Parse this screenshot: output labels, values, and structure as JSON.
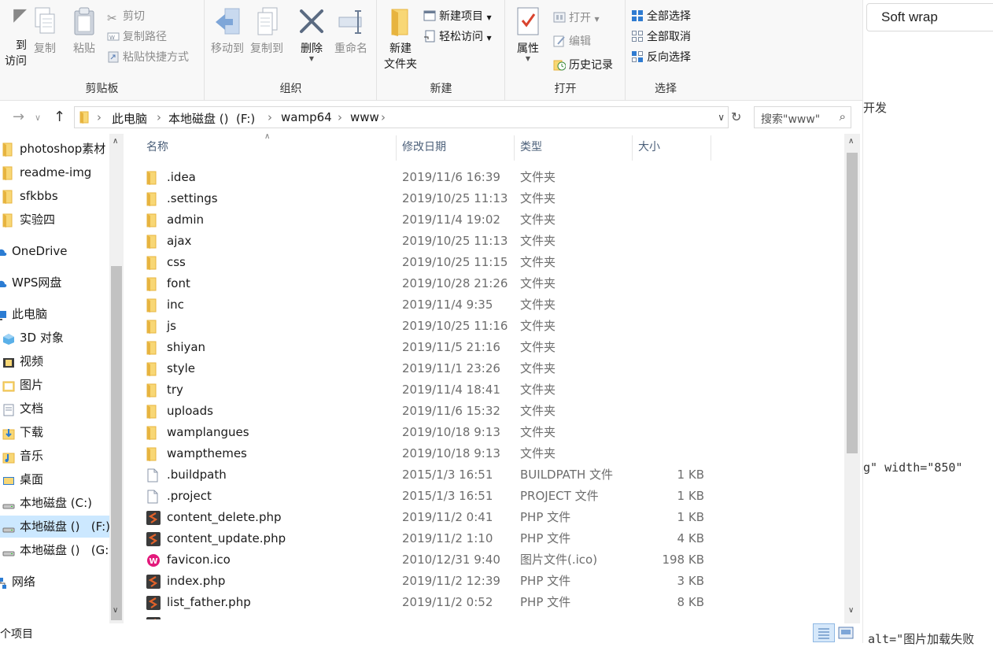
{
  "ribbon": {
    "clipboard": {
      "pin_label": "到\n访问",
      "copy": "复制",
      "paste": "粘贴",
      "cut": "剪切",
      "copy_path": "复制路径",
      "paste_shortcut": "粘贴快捷方式",
      "group_label": "剪贴板"
    },
    "organize": {
      "move_to": "移动到",
      "copy_to": "复制到",
      "delete": "删除",
      "rename": "重命名",
      "group_label": "组织"
    },
    "new": {
      "new_folder_1": "新建",
      "new_folder_2": "文件夹",
      "new_item": "新建项目",
      "easy_access": "轻松访问",
      "group_label": "新建"
    },
    "open": {
      "properties": "属性",
      "open": "打开",
      "edit": "编辑",
      "history": "历史记录",
      "group_label": "打开"
    },
    "select": {
      "select_all": "全部选择",
      "select_none": "全部取消",
      "invert": "反向选择",
      "group_label": "选择"
    }
  },
  "address": {
    "crumbs": [
      "此电脑",
      "本地磁盘 ()  (F:)",
      "wamp64",
      "www"
    ],
    "search_placeholder": "搜索\"www\""
  },
  "nav": {
    "items": [
      {
        "label": "photoshop素材",
        "icon": "folder-icon"
      },
      {
        "label": "readme-img",
        "icon": "folder-icon"
      },
      {
        "label": "sfkbbs",
        "icon": "folder-icon"
      },
      {
        "label": "实验四",
        "icon": "folder-icon"
      },
      {
        "label": "OneDrive",
        "icon": "cloud-icon"
      },
      {
        "label": "WPS网盘",
        "icon": "cloud-icon"
      },
      {
        "label": "此电脑",
        "icon": "computer-icon"
      },
      {
        "label": "3D 对象",
        "icon": "cube-icon"
      },
      {
        "label": "视频",
        "icon": "video-icon"
      },
      {
        "label": "图片",
        "icon": "picture-icon"
      },
      {
        "label": "文档",
        "icon": "document-icon"
      },
      {
        "label": "下载",
        "icon": "download-icon"
      },
      {
        "label": "音乐",
        "icon": "music-icon"
      },
      {
        "label": "桌面",
        "icon": "desktop-icon"
      },
      {
        "label": "本地磁盘 (C:)",
        "icon": "drive-icon"
      },
      {
        "label": "本地磁盘 ()   (F:)",
        "icon": "drive-icon",
        "selected": true
      },
      {
        "label": "本地磁盘 ()   (G:",
        "icon": "drive-icon"
      },
      {
        "label": "网络",
        "icon": "network-icon"
      }
    ]
  },
  "columns": {
    "name": "名称",
    "date": "修改日期",
    "type": "类型",
    "size": "大小"
  },
  "files": [
    {
      "name": ".idea",
      "date": "2019/11/6 16:39",
      "type": "文件夹",
      "size": "",
      "icon": "folder-icon"
    },
    {
      "name": ".settings",
      "date": "2019/10/25 11:13",
      "type": "文件夹",
      "size": "",
      "icon": "folder-icon"
    },
    {
      "name": "admin",
      "date": "2019/11/4 19:02",
      "type": "文件夹",
      "size": "",
      "icon": "folder-icon"
    },
    {
      "name": "ajax",
      "date": "2019/10/25 11:13",
      "type": "文件夹",
      "size": "",
      "icon": "folder-icon"
    },
    {
      "name": "css",
      "date": "2019/10/25 11:15",
      "type": "文件夹",
      "size": "",
      "icon": "folder-icon"
    },
    {
      "name": "font",
      "date": "2019/10/28 21:26",
      "type": "文件夹",
      "size": "",
      "icon": "folder-icon"
    },
    {
      "name": "inc",
      "date": "2019/11/4 9:35",
      "type": "文件夹",
      "size": "",
      "icon": "folder-icon"
    },
    {
      "name": "js",
      "date": "2019/10/25 11:16",
      "type": "文件夹",
      "size": "",
      "icon": "folder-icon"
    },
    {
      "name": "shiyan",
      "date": "2019/11/5 21:16",
      "type": "文件夹",
      "size": "",
      "icon": "folder-icon"
    },
    {
      "name": "style",
      "date": "2019/11/1 23:26",
      "type": "文件夹",
      "size": "",
      "icon": "folder-icon"
    },
    {
      "name": "try",
      "date": "2019/11/4 18:41",
      "type": "文件夹",
      "size": "",
      "icon": "folder-icon"
    },
    {
      "name": "uploads",
      "date": "2019/11/6 15:32",
      "type": "文件夹",
      "size": "",
      "icon": "folder-icon"
    },
    {
      "name": "wamplangues",
      "date": "2019/10/18 9:13",
      "type": "文件夹",
      "size": "",
      "icon": "folder-icon"
    },
    {
      "name": "wampthemes",
      "date": "2019/10/18 9:13",
      "type": "文件夹",
      "size": "",
      "icon": "folder-icon"
    },
    {
      "name": ".buildpath",
      "date": "2015/1/3 16:51",
      "type": "BUILDPATH 文件",
      "size": "1 KB",
      "icon": "blank-file-icon"
    },
    {
      "name": ".project",
      "date": "2015/1/3 16:51",
      "type": "PROJECT 文件",
      "size": "1 KB",
      "icon": "blank-file-icon"
    },
    {
      "name": "content_delete.php",
      "date": "2019/11/2 0:41",
      "type": "PHP 文件",
      "size": "1 KB",
      "icon": "php-file-icon"
    },
    {
      "name": "content_update.php",
      "date": "2019/11/2 1:10",
      "type": "PHP 文件",
      "size": "4 KB",
      "icon": "php-file-icon"
    },
    {
      "name": "favicon.ico",
      "date": "2010/12/31 9:40",
      "type": "图片文件(.ico)",
      "size": "198 KB",
      "icon": "wamp-ico-icon"
    },
    {
      "name": "index.php",
      "date": "2019/11/2 12:39",
      "type": "PHP 文件",
      "size": "3 KB",
      "icon": "php-file-icon"
    },
    {
      "name": "list_father.php",
      "date": "2019/11/2 0:52",
      "type": "PHP 文件",
      "size": "8 KB",
      "icon": "php-file-icon"
    }
  ],
  "status": {
    "item_count": "个项目"
  },
  "editor": {
    "softwrap": "Soft wrap",
    "line1": "开发",
    "line2": "g\" width=\"850\"",
    "line3": "alt=\"图片加载失败"
  },
  "colors": {
    "folder": "#f8d775",
    "folder_dark": "#e7b43f",
    "php": "#e2622a",
    "wamp": "#e3197b",
    "selection": "#cce8ff",
    "header_text": "#4c607a"
  }
}
